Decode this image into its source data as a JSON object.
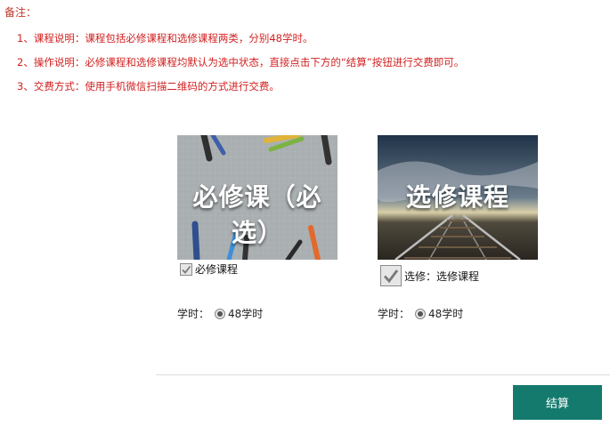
{
  "notes": {
    "title": "备注：",
    "items": [
      "1、课程说明：课程包括必修课程和选修课程两类，分别48学时。",
      "2、操作说明：必修课程和选修课程均默认为选中状态，直接点击下方的“结算”按钮进行交费即可。",
      "3、交费方式：使用手机微信扫描二维码的方式进行交费。"
    ]
  },
  "courses": [
    {
      "image_caption": "必修课（必选）",
      "label": "必修课程",
      "checked": true,
      "hours_label": "学时：",
      "hours_value": "48学时"
    },
    {
      "image_caption": "选修课程",
      "label": "选修：选修课程",
      "checked": true,
      "hours_label": "学时：",
      "hours_value": "48学时"
    }
  ],
  "actions": {
    "submit_label": "结算"
  },
  "colors": {
    "note_red": "#d21f1f",
    "submit_bg": "#157a6e"
  }
}
